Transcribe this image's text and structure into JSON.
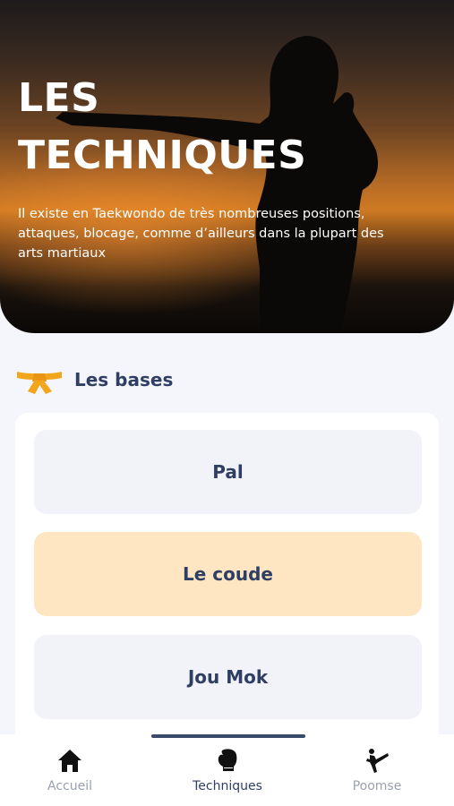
{
  "hero": {
    "title_line1": "LES",
    "title_line2": "TECHNIQUES",
    "description": "Il existe en Taekwondo de très nombreuses positions, attaques, blocage, comme d’ailleurs dans la plupart des arts martiaux"
  },
  "section": {
    "icon": "yellow-belt-icon",
    "title": "Les bases"
  },
  "techniques": [
    {
      "label": "Pal",
      "selected": false
    },
    {
      "label": "Le coude",
      "selected": true
    },
    {
      "label": "Jou Mok",
      "selected": false
    }
  ],
  "tabbar": {
    "tabs": [
      {
        "label": "Accueil",
        "icon": "home-icon",
        "active": false
      },
      {
        "label": "Techniques",
        "icon": "boxing-glove-icon",
        "active": true
      },
      {
        "label": "Poomse",
        "icon": "kick-icon",
        "active": false
      }
    ]
  },
  "colors": {
    "accent_active_item": "#fde6c1",
    "text_primary": "#2f3e63",
    "tab_inactive": "#9aa1ad",
    "belt": "#f2a61d"
  }
}
